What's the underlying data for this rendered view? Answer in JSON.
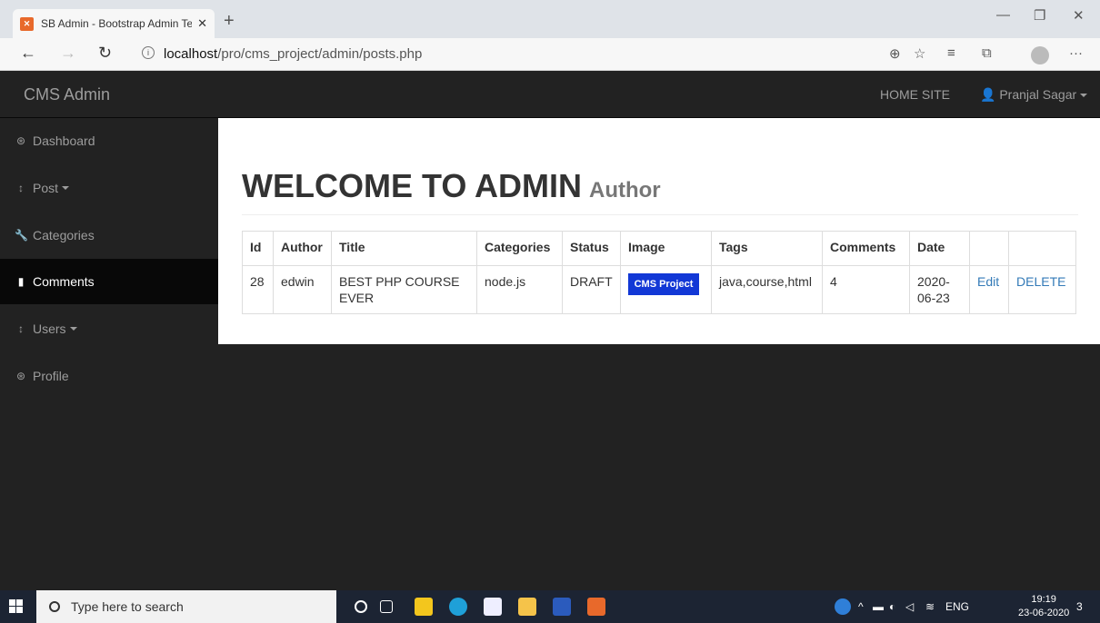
{
  "browser": {
    "tab_title": "SB Admin - Bootstrap Admin Ten",
    "favicon": "xampp-icon",
    "url_host": "localhost",
    "url_path": "/pro/cms_project/admin/posts.php"
  },
  "navbar": {
    "brand": "CMS Admin",
    "home_site": "HOME SITE",
    "user": "Pranjal Sagar"
  },
  "sidebar": {
    "items": [
      {
        "label": "Dashboard",
        "icon": "dashboard-icon"
      },
      {
        "label": "Post",
        "icon": "arrows-v-icon"
      },
      {
        "label": "Categories",
        "icon": "wrench-icon"
      },
      {
        "label": "Comments",
        "icon": "file-icon"
      },
      {
        "label": "Users",
        "icon": "arrows-v-icon"
      },
      {
        "label": "Profile",
        "icon": "dashboard-icon"
      }
    ],
    "active": "Comments"
  },
  "main": {
    "heading": "WELCOME TO ADMIN",
    "subheading": "Author",
    "table": {
      "headers": [
        "Id",
        "Author",
        "Title",
        "Categories",
        "Status",
        "Image",
        "Tags",
        "Comments",
        "Date"
      ],
      "rows": [
        {
          "id": "28",
          "author": "edwin",
          "title": "BEST PHP COURSE EVER",
          "categories": "node.js",
          "status": "DRAFT",
          "image_text": "CMS Project",
          "tags": "java,course,html",
          "comments": "4",
          "date": "2020-06-23",
          "edit": "Edit",
          "delete": "DELETE"
        }
      ]
    }
  },
  "taskbar": {
    "search_placeholder": "Type here to search",
    "language": "ENG",
    "time": "19:19",
    "date": "23-06-2020",
    "notifications": "3"
  },
  "colors": {
    "navbar_bg": "#222222",
    "active_item_bg": "#080808",
    "link": "#337ab7",
    "image_badge": "#1238d6"
  }
}
